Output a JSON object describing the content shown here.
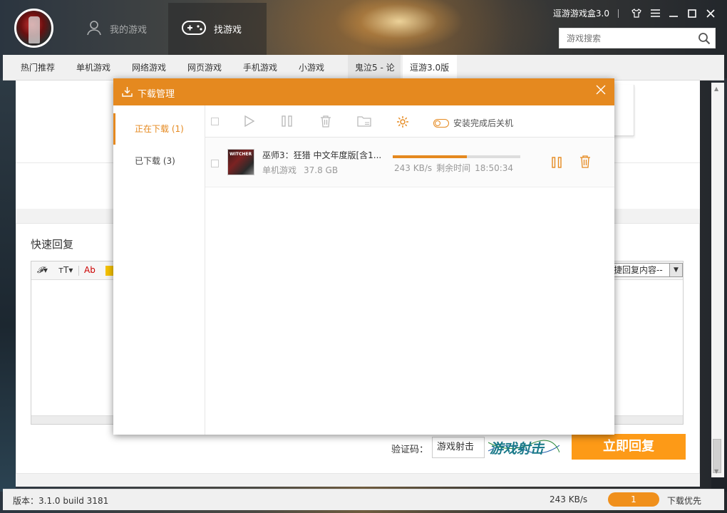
{
  "header": {
    "app_title": "逗游游戏盒3.0",
    "nav_mine": "我的游戏",
    "nav_find": "找游戏",
    "search_placeholder": "游戏搜索"
  },
  "categories": [
    "热门推荐",
    "单机游戏",
    "网络游戏",
    "网页游戏",
    "手机游戏",
    "小游戏",
    "鬼泣5 - 论",
    "逗游3.0版"
  ],
  "page": {
    "reply_title": "快速回复",
    "editor_font_label": "Ab",
    "quick_reply_select": "捷回复内容--",
    "captcha_label": "验证码：",
    "captcha_value": "游戏射击",
    "captcha_image_text": "游戏射击",
    "submit_label": "立即回复"
  },
  "download_manager": {
    "title": "下载管理",
    "tabs": [
      {
        "label": "正在下载 (1)",
        "active": true
      },
      {
        "label": "已下载 (3)",
        "active": false
      }
    ],
    "toolbar_toggle_label": "安装完成后关机",
    "items": [
      {
        "name": "巫师3：狂猎  中文年度版[含1...",
        "category": "单机游戏",
        "size": "37.8 GB",
        "speed": "243 KB/s",
        "remaining_label": "剩余时间",
        "remaining": "18:50:34",
        "progress": 0.58,
        "thumb_text": "WITCHER"
      }
    ]
  },
  "status": {
    "version": "版本：3.1.0 build 3181",
    "speed": "243 KB/s",
    "download_count": "1",
    "priority": "下载优先"
  },
  "colors": {
    "accent": "#e5891f",
    "submit": "#fd9a17"
  }
}
